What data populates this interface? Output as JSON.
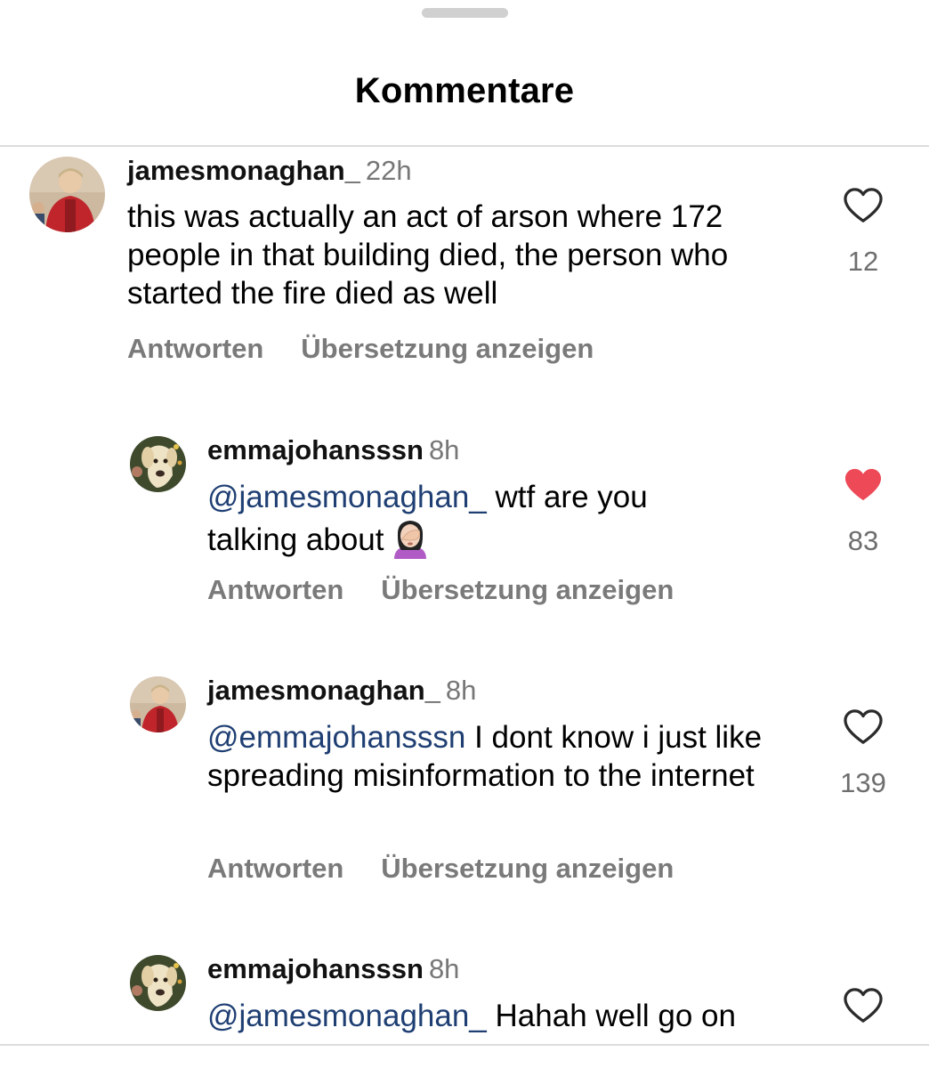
{
  "sheet": {
    "title": "Kommentare"
  },
  "comments": [
    {
      "username": "jamesmonaghan_",
      "time": "22h",
      "mention": "",
      "text": "this was actually an act of arson where 172 people in that building died, the person who started the fire died as well",
      "reply_label": "Antworten",
      "translate_label": "Übersetzung anzeigen",
      "likes": "12",
      "liked": false
    },
    {
      "username": "emmajohansssn",
      "time": "8h",
      "mention": "@jamesmonaghan_",
      "text": "wtf are you talking about",
      "emoji": "woman-facepalming-emoji",
      "reply_label": "Antworten",
      "translate_label": "Übersetzung anzeigen",
      "likes": "83",
      "liked": true
    },
    {
      "username": "jamesmonaghan_",
      "time": "8h",
      "mention": "@emmajohansssn",
      "text": "I dont know i just like spreading misinformation to the internet",
      "reply_label": "Antworten",
      "translate_label": "Übersetzung anzeigen",
      "likes": "139",
      "liked": false
    },
    {
      "username": "emmajohansssn",
      "time": "8h",
      "mention": "@jamesmonaghan_",
      "text": "Hahah well go on",
      "liked": false
    }
  ],
  "colors": {
    "mention": "#1f3f73",
    "liked_heart": "#ed4956",
    "muted": "#7a7a7a"
  }
}
